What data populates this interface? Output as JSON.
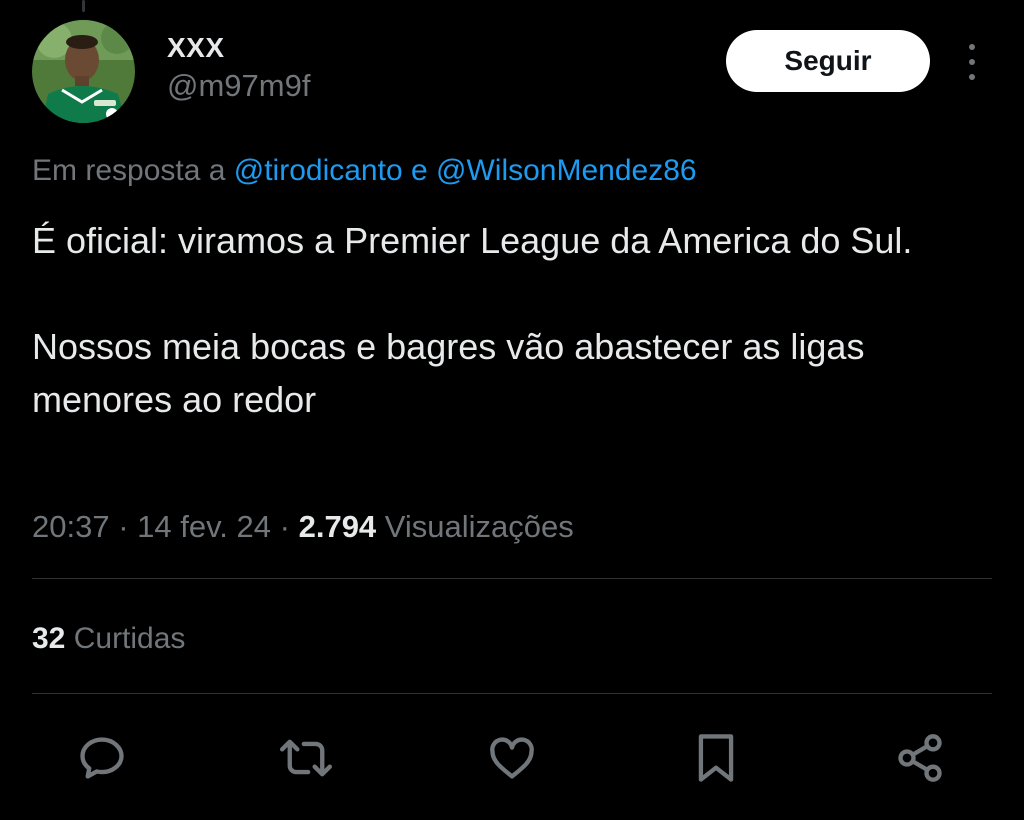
{
  "author": {
    "display_name": "XXX",
    "handle": "@m97m9f"
  },
  "follow_label": "Seguir",
  "reply_to": {
    "prefix": "Em resposta a",
    "mention_1": "@tirodicanto",
    "connector": "e",
    "mention_2": "@WilsonMendez86"
  },
  "tweet": {
    "paragraph_1": "É oficial: viramos a Premier League da America do Sul.",
    "paragraph_2": "Nossos meia bocas e bagres vão abastecer as ligas menores ao redor"
  },
  "meta": {
    "time": "20:37",
    "separator": "·",
    "date": "14 fev. 24",
    "views_count": "2.794",
    "views_label": "Visualizações"
  },
  "engagement": {
    "likes_count": "32",
    "likes_label": "Curtidas"
  },
  "actions": [
    {
      "icon": "reply-icon"
    },
    {
      "icon": "retweet-icon"
    },
    {
      "icon": "like-icon"
    },
    {
      "icon": "bookmark-icon"
    },
    {
      "icon": "share-icon"
    }
  ],
  "colors": {
    "background": "#000000",
    "text_primary": "#e7e9ea",
    "text_secondary": "#71767b",
    "link": "#1d9bf0",
    "divider": "#2f3336",
    "button_bg": "#ffffff"
  }
}
